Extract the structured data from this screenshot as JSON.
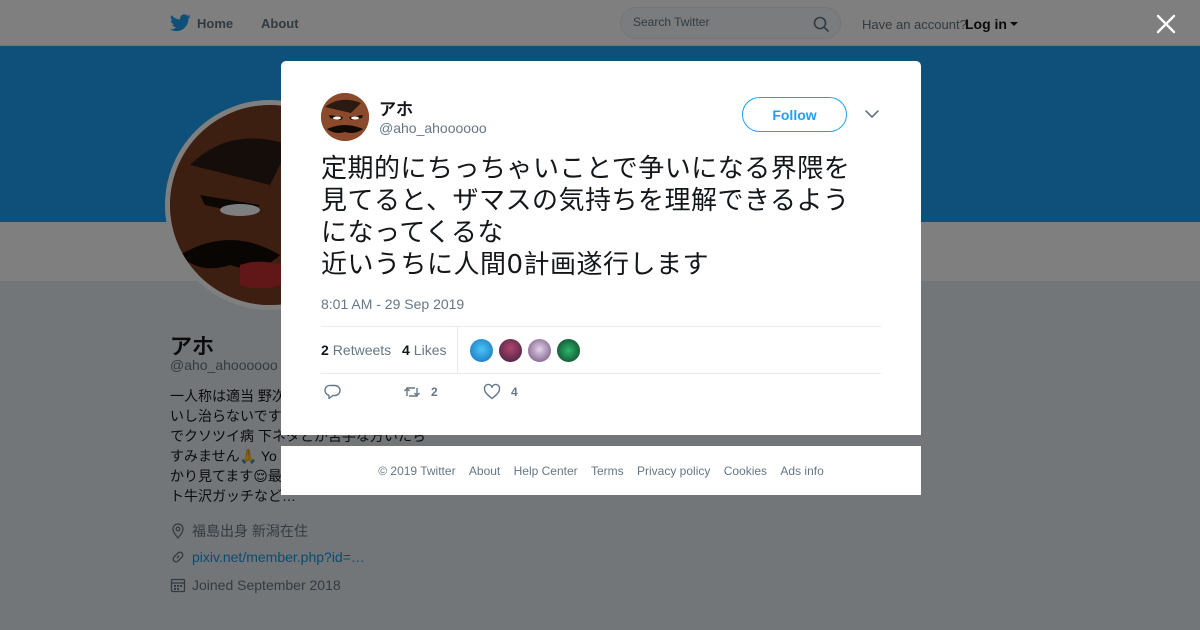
{
  "nav": {
    "home_label": "Home",
    "about_label": "About",
    "search_placeholder": "Search Twitter",
    "have_account": "Have an account?",
    "login_label": "Log in",
    "brand_color": "#1da1f2"
  },
  "profile": {
    "name": "アホ",
    "handle": "@aho_ahoooooo",
    "bio_lines": [
      "一人称は適当 野次",
      "いし治らないです",
      "でクソツイ病 下ネタとか苦手な方いたち",
      "すみません🙏 Yo",
      "かり見てます😌最",
      "ト牛沢ガッチなど…"
    ],
    "location": "福島出身 新潟在住",
    "website": "pixiv.net/member.php?id=…",
    "joined": "Joined September 2018"
  },
  "tweet": {
    "author_name": "アホ",
    "author_handle": "@aho_ahoooooo",
    "follow_label": "Follow",
    "text_lines": [
      "定期的にちっちゃいことで争いになる界隈を",
      "見てると、ザマスの気持ちを理解できるよう",
      "になってくるな",
      "近いうちに人間0計画遂行します"
    ],
    "timestamp": "8:01 AM - 29 Sep 2019",
    "retweets_count": "2",
    "retweets_label": "Retweets",
    "likes_count": "4",
    "likes_label": "Likes",
    "action_retweet_count": "2",
    "action_like_count": "4"
  },
  "footer": {
    "links": [
      "© 2019 Twitter",
      "About",
      "Help Center",
      "Terms",
      "Privacy policy",
      "Cookies",
      "Ads info"
    ]
  }
}
